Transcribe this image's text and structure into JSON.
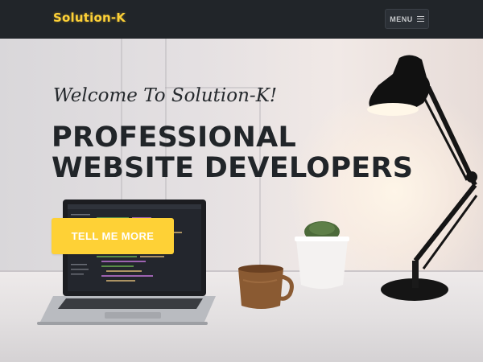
{
  "navbar": {
    "brand": "Solution-K",
    "menu_label": "MENU",
    "menu_icon": "hamburger-icon"
  },
  "hero": {
    "subheading": "Welcome To Solution-K!",
    "heading_line1": "PROFESSIONAL",
    "heading_line2": "WEBSITE DEVELOPERS",
    "cta_label": "TELL ME MORE"
  },
  "colors": {
    "accent": "#fed136",
    "navbar_bg": "#212529",
    "heading_text": "#212529"
  }
}
